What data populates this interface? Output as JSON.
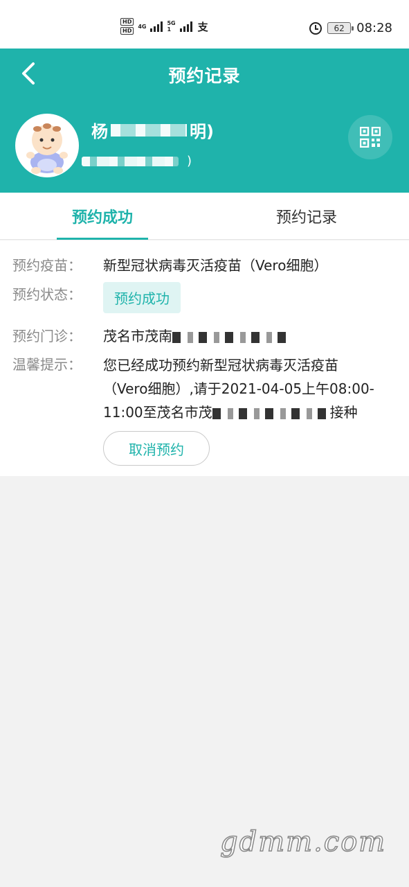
{
  "status_bar": {
    "hd1": "HD",
    "hd2": "HD",
    "net1": "4G",
    "net2_top": "5G",
    "net2_bottom": "1",
    "wechat": "支",
    "battery": "62",
    "time": "08:28"
  },
  "header": {
    "title": "预约记录",
    "user_name_prefix": "杨",
    "user_name_suffix": "明)",
    "user_sub_suffix": ")"
  },
  "tabs": [
    {
      "label": "预约成功",
      "active": true
    },
    {
      "label": "预约记录",
      "active": false
    }
  ],
  "details": {
    "vaccine_label": "预约疫苗：",
    "vaccine_value": "新型冠状病毒灭活疫苗（Vero细胞）",
    "status_label": "预约状态：",
    "status_value": "预约成功",
    "clinic_label": "预约门诊：",
    "clinic_value_prefix": "茂名市茂南",
    "tip_label": "温馨提示：",
    "tip_line1": "您已经成功预约新型冠状病毒灭活疫苗",
    "tip_line2": "（Vero细胞）,请于2021-04-05上午08:00-",
    "tip_line3_prefix": "11:00至茂名市茂",
    "tip_line3_suffix": "接种"
  },
  "actions": {
    "cancel_label": "取消预约"
  },
  "watermark": "gdmm.com",
  "colors": {
    "accent": "#1fb3ab",
    "badge_bg": "#dff4f3",
    "label_gray": "#8a8a8a"
  }
}
